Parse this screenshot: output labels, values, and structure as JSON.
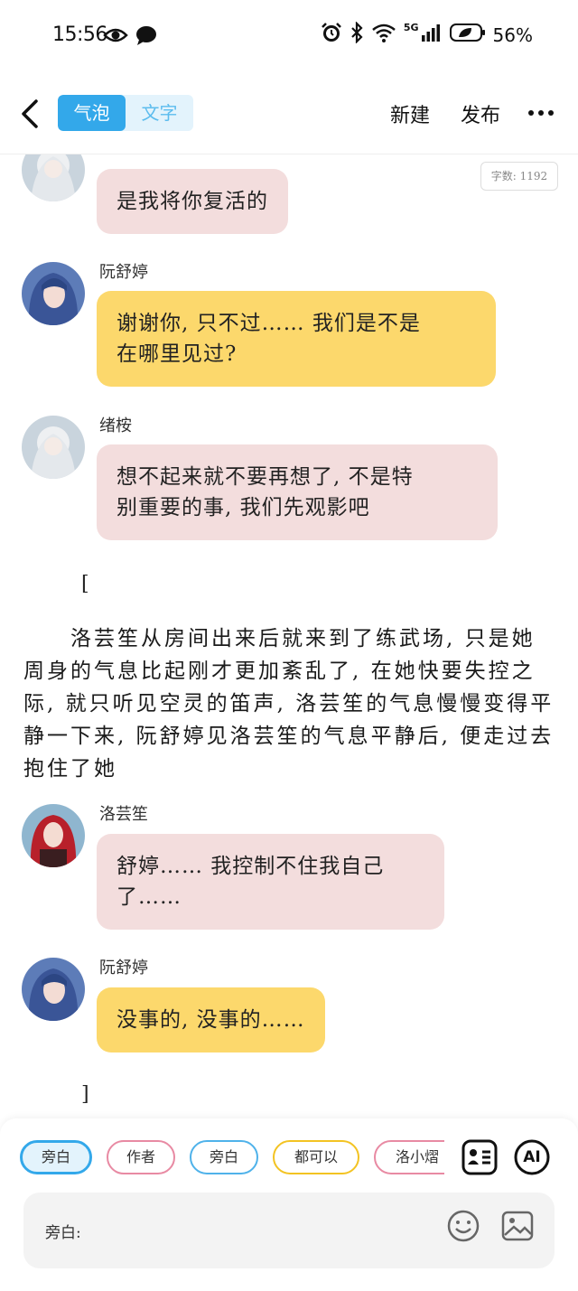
{
  "status_bar": {
    "time": "15:56",
    "network": "5G",
    "battery": "56%",
    "icons": [
      "eye-icon",
      "message-icon",
      "alarm-icon",
      "bluetooth-icon",
      "wifi-icon",
      "signal-icon",
      "battery-icon"
    ]
  },
  "header": {
    "tabs": [
      {
        "label": "气泡",
        "active": true
      },
      {
        "label": "文字",
        "active": false
      }
    ],
    "new_label": "新建",
    "publish_label": "发布"
  },
  "word_count": "字数: 1192",
  "messages": [
    {
      "type": "bubble",
      "speaker": "",
      "color": "pink",
      "avatar": "white-hair-girl",
      "lines": [
        "是我将你复活的"
      ]
    },
    {
      "type": "bubble",
      "speaker": "阮舒婷",
      "color": "yellow",
      "avatar": "blue-hair-girl",
      "lines": [
        "谢谢你, 只不过…… 我们是不是",
        "在哪里见过?"
      ]
    },
    {
      "type": "bubble",
      "speaker": "绪桉",
      "color": "pink",
      "avatar": "white-hair-girl",
      "lines": [
        "想不起来就不要再想了, 不是特",
        "别重要的事, 我们先观影吧"
      ]
    },
    {
      "type": "bracket",
      "text": "["
    },
    {
      "type": "narration",
      "text": "　　洛芸笙从房间出来后就来到了练武场, 只是她周身的气息比起刚才更加紊乱了, 在她快要失控之际, 就只听见空灵的笛声, 洛芸笙的气息慢慢变得平静一下来, 阮舒婷见洛芸笙的气息平静后, 便走过去抱住了她"
    },
    {
      "type": "bubble",
      "speaker": "洛芸笙",
      "color": "pink",
      "avatar": "red-hair-girl",
      "lines": [
        "舒婷…… 我控制不住我自己",
        "了……"
      ]
    },
    {
      "type": "bubble",
      "speaker": "阮舒婷",
      "color": "yellow",
      "avatar": "blue-hair-girl",
      "lines": [
        "没事的, 没事的……"
      ]
    },
    {
      "type": "bracket",
      "text": "]"
    }
  ],
  "bottom": {
    "chips": [
      {
        "label": "旁白",
        "style": "selected"
      },
      {
        "label": "作者",
        "style": "pink"
      },
      {
        "label": "旁白",
        "style": "blue"
      },
      {
        "label": "都可以",
        "style": "yellow"
      },
      {
        "label": "洛小熠",
        "style": "pink"
      }
    ],
    "ai_label": "AI",
    "input_label": "旁白:"
  },
  "colors": {
    "accent": "#33a8ea",
    "pink_bubble": "#f3dddd",
    "yellow_bubble": "#fcd86c"
  }
}
